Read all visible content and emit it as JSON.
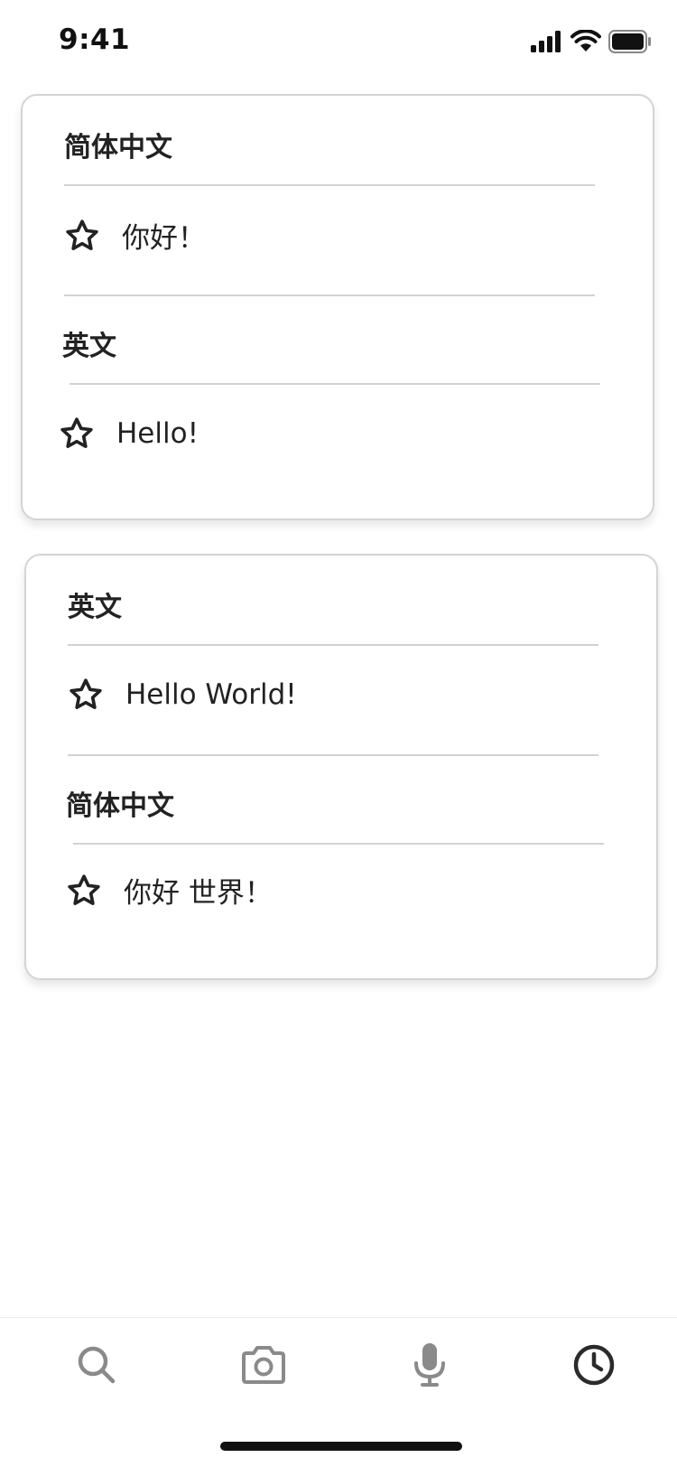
{
  "status_bar": {
    "time": "9:41",
    "icons": [
      "cellular-signal-icon",
      "wifi-icon",
      "battery-icon"
    ]
  },
  "translations": [
    {
      "source_language": "简体中文",
      "source_text": "你好！",
      "target_language": "英文",
      "target_text": "Hello!"
    },
    {
      "source_language": "英文",
      "source_text": "Hello World!",
      "target_language": "简体中文",
      "target_text": "你好 世界！"
    }
  ],
  "tab_bar": {
    "tabs": [
      {
        "icon": "search-icon",
        "active": false
      },
      {
        "icon": "camera-icon",
        "active": false
      },
      {
        "icon": "microphone-icon",
        "active": false
      },
      {
        "icon": "history-clock-icon",
        "active": true
      }
    ]
  },
  "colors": {
    "text": "#222222",
    "divider": "#d2d2d2",
    "card_border": "#d4d4d4",
    "tab_inactive": "#8a8a8a",
    "tab_active": "#2b2b2b"
  }
}
